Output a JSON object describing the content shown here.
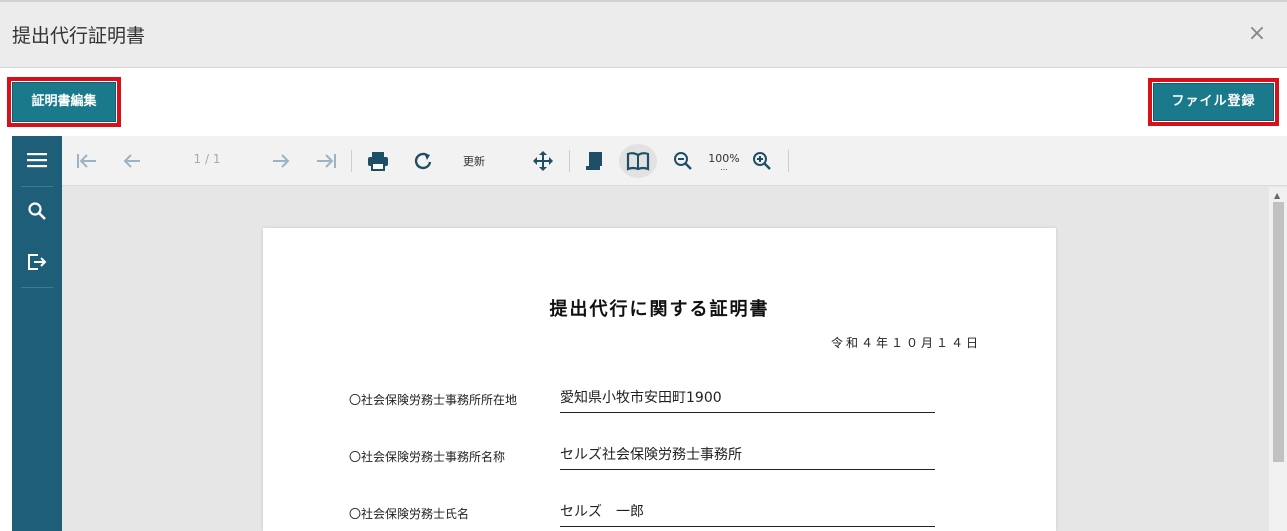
{
  "dialog": {
    "title": "提出代行証明書",
    "close_icon": "×"
  },
  "actions": {
    "edit_certificate": "証明書編集",
    "register_file": "ファイル登録",
    "highlight_color": "#d8101a",
    "button_color": "#1a7a8c"
  },
  "viewer": {
    "sidebar_color": "#1f5e78",
    "page_indicator": "1 / 1",
    "refresh_label": "更新",
    "zoom_level": "100%",
    "zoom_dots": "..."
  },
  "document": {
    "title": "提出代行に関する証明書",
    "date": "令和４年１０月１４日",
    "fields": [
      {
        "label": "〇社会保険労務士事務所所在地",
        "value": "愛知県小牧市安田町1900"
      },
      {
        "label": "〇社会保険労務士事務所名称",
        "value": "セルズ社会保険労務士事務所"
      },
      {
        "label": "〇社会保険労務士氏名",
        "value": "セルズ　一郎"
      }
    ]
  }
}
